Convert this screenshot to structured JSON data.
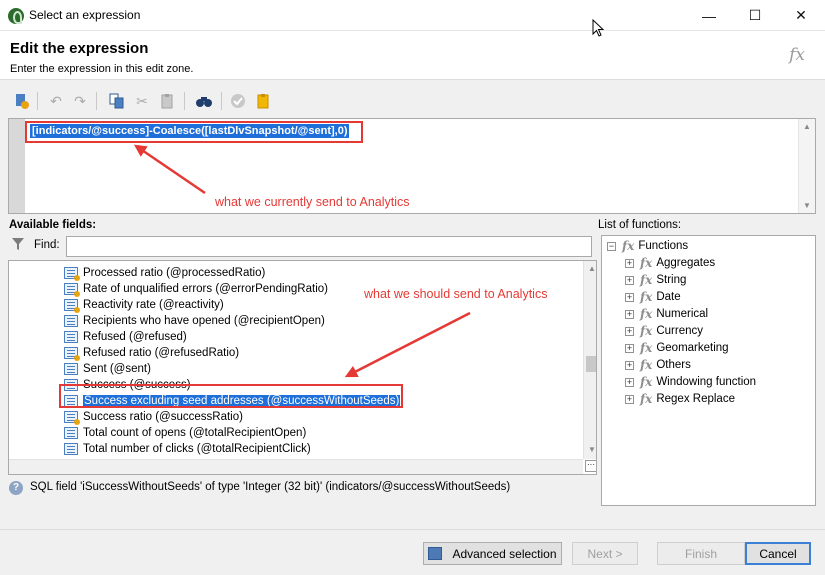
{
  "window": {
    "title": "Select an expression",
    "controls": [
      "—",
      "☐",
      "✕"
    ]
  },
  "header": {
    "title": "Edit the expression",
    "subtitle": "Enter the expression in this edit zone.",
    "fx": "fx"
  },
  "editor": {
    "expression": "[indicators/@success]-Coalesce([lastDlvSnapshot/@sent],0)"
  },
  "annotations": {
    "current": "what we currently send to Analytics",
    "should": "what we should send to Analytics"
  },
  "fields": {
    "label": "Available fields:",
    "find_label": "Find:",
    "find_value": "",
    "items": [
      {
        "label": "Processed ratio (@processedRatio)",
        "calc": true
      },
      {
        "label": "Rate of unqualified errors (@errorPendingRatio)",
        "calc": true
      },
      {
        "label": "Reactivity rate (@reactivity)",
        "calc": true
      },
      {
        "label": "Recipients who have opened (@recipientOpen)",
        "calc": false
      },
      {
        "label": "Refused (@refused)",
        "calc": false
      },
      {
        "label": "Refused ratio (@refusedRatio)",
        "calc": true
      },
      {
        "label": "Sent (@sent)",
        "calc": false
      },
      {
        "label": "Success (@success)",
        "calc": false
      },
      {
        "label": "Success excluding seed addresses (@successWithoutSeeds)",
        "calc": false,
        "selected": true
      },
      {
        "label": "Success ratio (@successRatio)",
        "calc": true
      },
      {
        "label": "Total count of opens (@totalRecipientOpen)",
        "calc": false
      },
      {
        "label": "Total number of clicks (@totalRecipientClick)",
        "calc": false
      }
    ]
  },
  "functions": {
    "label": "List of functions:",
    "root": "Functions",
    "items": [
      "Aggregates",
      "String",
      "Date",
      "Numerical",
      "Currency",
      "Geomarketing",
      "Others",
      "Windowing function",
      "Regex Replace"
    ]
  },
  "info": {
    "text": "SQL field 'iSuccessWithoutSeeds' of type 'Integer (32 bit)' (indicators/@successWithoutSeeds)"
  },
  "buttons": {
    "advanced": "Advanced selection",
    "next": "Next >",
    "finish": "Finish",
    "cancel": "Cancel"
  }
}
